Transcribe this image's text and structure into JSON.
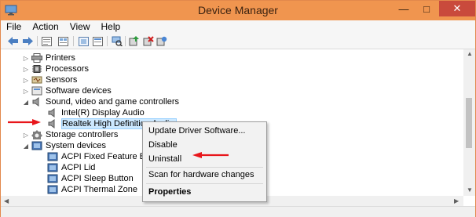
{
  "window": {
    "title": "Device Manager",
    "minimize": "—",
    "maximize": "□",
    "close": "✕"
  },
  "menu": [
    "File",
    "Action",
    "View",
    "Help"
  ],
  "toolbar": [
    "back-icon",
    "forward-icon",
    "properties-icon",
    "help-icon",
    "view-icon",
    "scan-icon",
    "update-driver-icon",
    "uninstall-icon",
    "enable-icon"
  ],
  "tree": [
    {
      "label": "Printers",
      "icon": "printer-icon",
      "level": 1,
      "expander": "▷"
    },
    {
      "label": "Processors",
      "icon": "processor-icon",
      "level": 1,
      "expander": "▷"
    },
    {
      "label": "Sensors",
      "icon": "sensor-icon",
      "level": 1,
      "expander": "▷"
    },
    {
      "label": "Software devices",
      "icon": "software-device-icon",
      "level": 1,
      "expander": "▷"
    },
    {
      "label": "Sound, video and game controllers",
      "icon": "speaker-icon",
      "level": 1,
      "expander": "◢"
    },
    {
      "label": "Intel(R) Display Audio",
      "icon": "speaker-icon",
      "level": 2,
      "expander": ""
    },
    {
      "label": "Realtek High Definition Audio",
      "icon": "speaker-icon",
      "level": 2,
      "expander": "",
      "selected": true
    },
    {
      "label": "Storage controllers",
      "icon": "storage-icon",
      "level": 1,
      "expander": "▷"
    },
    {
      "label": "System devices",
      "icon": "system-folder-icon",
      "level": 1,
      "expander": "◢"
    },
    {
      "label": "ACPI Fixed Feature Butt",
      "icon": "acpi-icon",
      "level": 2,
      "expander": ""
    },
    {
      "label": "ACPI Lid",
      "icon": "acpi-icon",
      "level": 2,
      "expander": ""
    },
    {
      "label": "ACPI Sleep Button",
      "icon": "acpi-icon",
      "level": 2,
      "expander": ""
    },
    {
      "label": "ACPI Thermal Zone",
      "icon": "acpi-icon",
      "level": 2,
      "expander": ""
    }
  ],
  "context_menu": {
    "items": [
      {
        "label": "Update Driver Software...",
        "bold": false
      },
      {
        "label": "Disable",
        "bold": false
      },
      {
        "label": "Uninstall",
        "bold": false
      },
      {
        "label": "Scan for hardware changes",
        "bold": false
      },
      {
        "label": "Properties",
        "bold": true
      }
    ]
  },
  "colors": {
    "titlebar": "#f0954f",
    "selection": "#cce8ff",
    "annotation_arrow": "#e8161b"
  }
}
